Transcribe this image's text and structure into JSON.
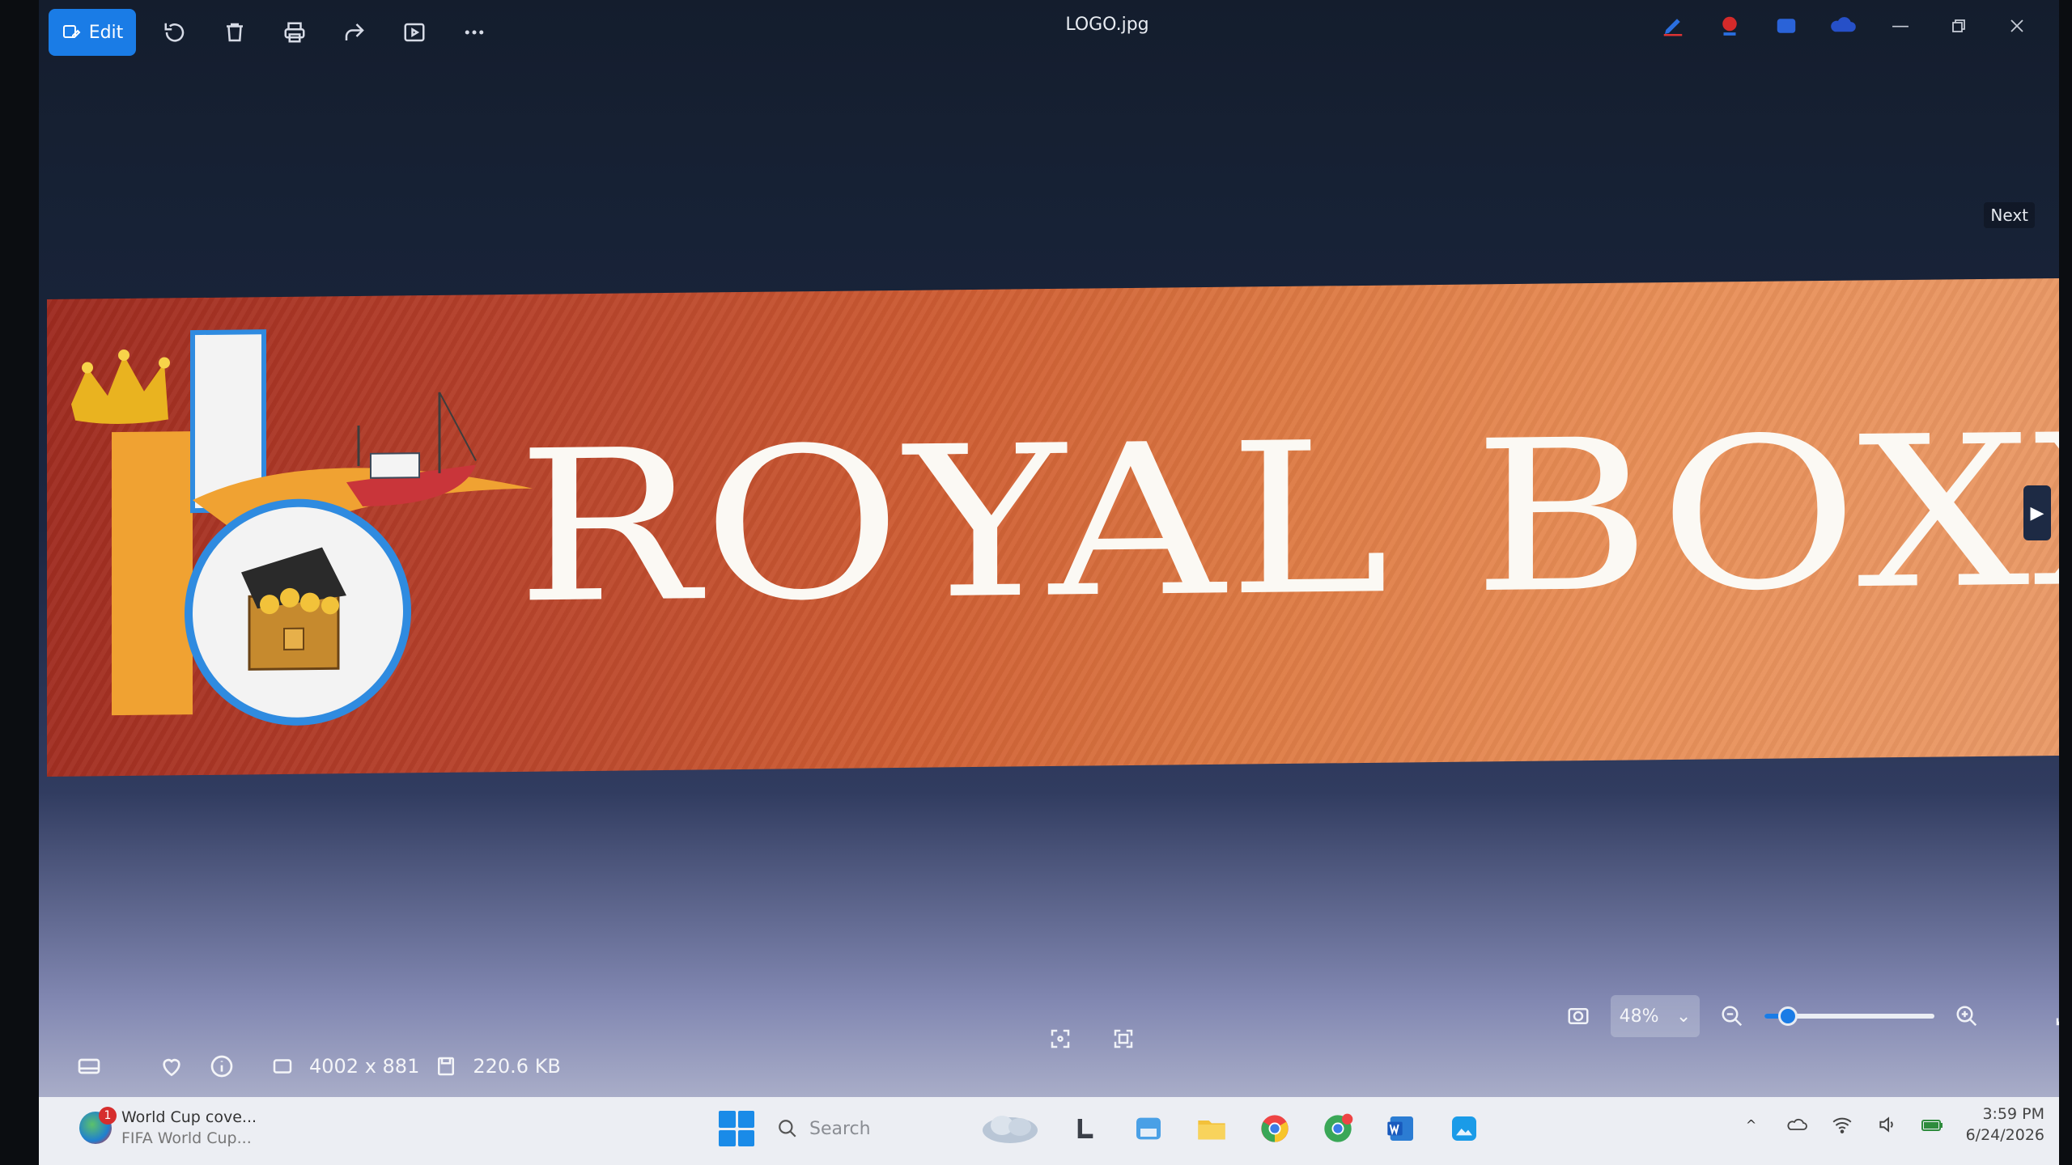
{
  "window": {
    "title": "LOGO.jpg",
    "edit_label": "Edit",
    "next_label": "Next"
  },
  "image": {
    "brand_text": "ROYAL BOXX",
    "colors": {
      "banner_start": "#9e2b20",
      "banner_end": "#e99a68",
      "logo_orange": "#f0a232",
      "logo_blue": "#2f8be0"
    }
  },
  "toolbar": {
    "icons": [
      "rotate-icon",
      "delete-icon",
      "print-icon",
      "share-icon",
      "slideshow-icon",
      "more-icon"
    ]
  },
  "status": {
    "dimensions": "4002 x 881",
    "file_size": "220.6 KB"
  },
  "zoom": {
    "level_label": "48%",
    "slider_value": 0.14
  },
  "taskbar": {
    "search_placeholder": "Search",
    "widget_title": "World Cup cove...",
    "widget_subtitle": "FIFA World Cup...",
    "widget_badge": "1",
    "time": "3:59 PM",
    "date": "6/24/2026"
  },
  "accent": "#1a7ce6"
}
